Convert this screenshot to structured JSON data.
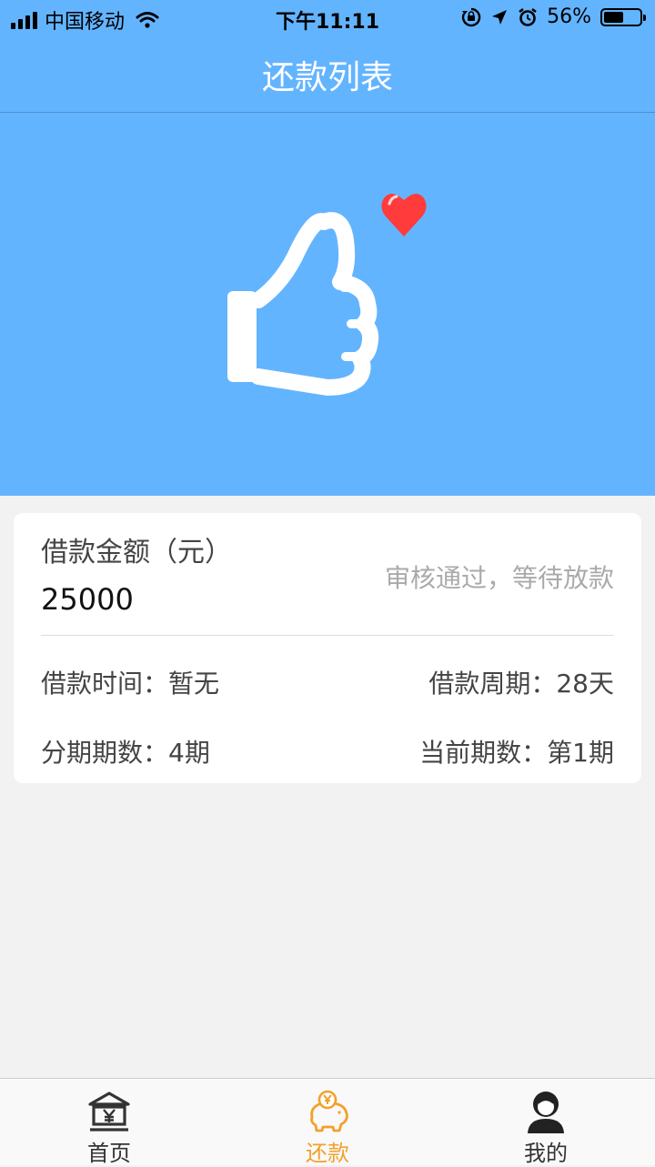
{
  "status_bar": {
    "carrier": "中国移动",
    "time": "下午11:11",
    "battery": "56%",
    "battery_level": 0.56
  },
  "nav": {
    "title": "还款列表"
  },
  "loan": {
    "amount_label": "借款金额（元）",
    "amount_value": "25000",
    "status": "审核通过，等待放款",
    "loan_time": "借款时间：暂无",
    "loan_period": "借款周期：28天",
    "installments": "分期期数：4期",
    "current_installment": "当前期数：第1期"
  },
  "tabs": [
    {
      "label": "首页",
      "icon": "bank-icon"
    },
    {
      "label": "还款",
      "icon": "piggy-bank-icon"
    },
    {
      "label": "我的",
      "icon": "user-icon"
    }
  ],
  "colors": {
    "header": "#63b4ff",
    "active_tab": "#f2a12a",
    "heart": "#ff3b3b"
  }
}
